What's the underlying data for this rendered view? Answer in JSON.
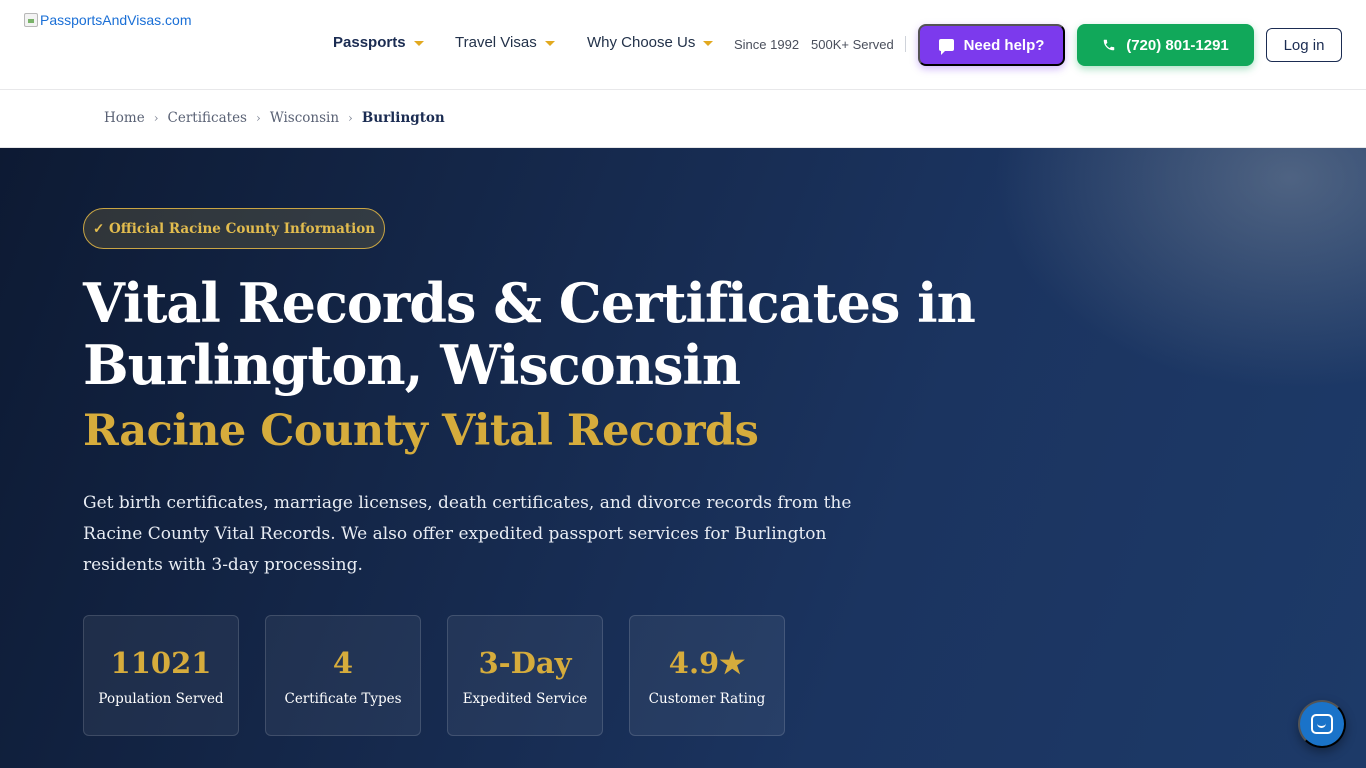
{
  "header": {
    "logo_text": "PassportsAndVisas.com",
    "nav": [
      {
        "label": "Passports"
      },
      {
        "label": "Travel Visas"
      },
      {
        "label": "Why Choose Us"
      }
    ],
    "trust_since": "Since 1992",
    "trust_served": "500K+ Served",
    "help_label": "Need help?",
    "phone_label": "(720) 801-1291",
    "login_label": "Log in"
  },
  "breadcrumb": {
    "items": [
      "Home",
      "Certificates",
      "Wisconsin"
    ],
    "current": "Burlington",
    "separator": "›"
  },
  "hero": {
    "badge": "✓ Official Racine County Information",
    "title": "Vital Records & Certificates in Burlington, Wisconsin",
    "subtitle": "Racine County Vital Records",
    "description": "Get birth certificates, marriage licenses, death certificates, and divorce records from the Racine County Vital Records. We also offer expedited passport services for Burlington residents with 3-day processing.",
    "stats": [
      {
        "value": "11021",
        "label": "Population Served"
      },
      {
        "value": "4",
        "label": "Certificate Types"
      },
      {
        "value": "3-Day",
        "label": "Expedited Service"
      },
      {
        "value": "4.9★",
        "label": "Customer Rating"
      }
    ]
  },
  "colors": {
    "accent_gold": "#d6ac3c",
    "help_purple": "#7c3aed",
    "phone_green": "#11a85a",
    "navy": "#1b2c52"
  },
  "icons": {
    "help": "chat-icon",
    "phone": "phone-icon",
    "chat_widget": "chat-bubble-icon"
  }
}
